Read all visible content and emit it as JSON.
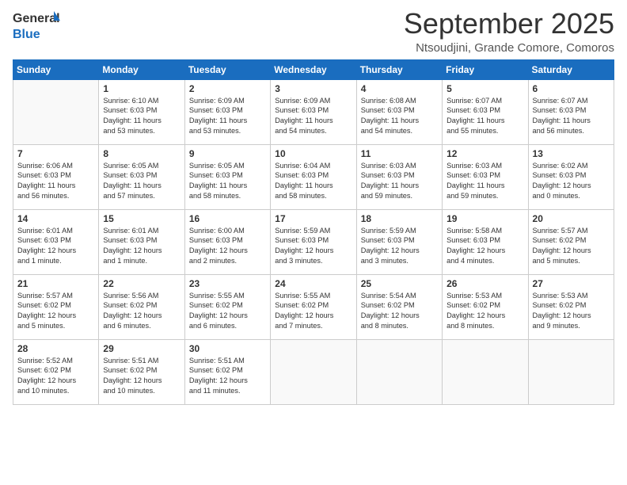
{
  "logo": {
    "general": "General",
    "blue": "Blue"
  },
  "header": {
    "month": "September 2025",
    "location": "Ntsoudjini, Grande Comore, Comoros"
  },
  "days": [
    "Sunday",
    "Monday",
    "Tuesday",
    "Wednesday",
    "Thursday",
    "Friday",
    "Saturday"
  ],
  "weeks": [
    [
      {
        "num": "",
        "lines": []
      },
      {
        "num": "1",
        "lines": [
          "Sunrise: 6:10 AM",
          "Sunset: 6:03 PM",
          "Daylight: 11 hours",
          "and 53 minutes."
        ]
      },
      {
        "num": "2",
        "lines": [
          "Sunrise: 6:09 AM",
          "Sunset: 6:03 PM",
          "Daylight: 11 hours",
          "and 53 minutes."
        ]
      },
      {
        "num": "3",
        "lines": [
          "Sunrise: 6:09 AM",
          "Sunset: 6:03 PM",
          "Daylight: 11 hours",
          "and 54 minutes."
        ]
      },
      {
        "num": "4",
        "lines": [
          "Sunrise: 6:08 AM",
          "Sunset: 6:03 PM",
          "Daylight: 11 hours",
          "and 54 minutes."
        ]
      },
      {
        "num": "5",
        "lines": [
          "Sunrise: 6:07 AM",
          "Sunset: 6:03 PM",
          "Daylight: 11 hours",
          "and 55 minutes."
        ]
      },
      {
        "num": "6",
        "lines": [
          "Sunrise: 6:07 AM",
          "Sunset: 6:03 PM",
          "Daylight: 11 hours",
          "and 56 minutes."
        ]
      }
    ],
    [
      {
        "num": "7",
        "lines": [
          "Sunrise: 6:06 AM",
          "Sunset: 6:03 PM",
          "Daylight: 11 hours",
          "and 56 minutes."
        ]
      },
      {
        "num": "8",
        "lines": [
          "Sunrise: 6:05 AM",
          "Sunset: 6:03 PM",
          "Daylight: 11 hours",
          "and 57 minutes."
        ]
      },
      {
        "num": "9",
        "lines": [
          "Sunrise: 6:05 AM",
          "Sunset: 6:03 PM",
          "Daylight: 11 hours",
          "and 58 minutes."
        ]
      },
      {
        "num": "10",
        "lines": [
          "Sunrise: 6:04 AM",
          "Sunset: 6:03 PM",
          "Daylight: 11 hours",
          "and 58 minutes."
        ]
      },
      {
        "num": "11",
        "lines": [
          "Sunrise: 6:03 AM",
          "Sunset: 6:03 PM",
          "Daylight: 11 hours",
          "and 59 minutes."
        ]
      },
      {
        "num": "12",
        "lines": [
          "Sunrise: 6:03 AM",
          "Sunset: 6:03 PM",
          "Daylight: 11 hours",
          "and 59 minutes."
        ]
      },
      {
        "num": "13",
        "lines": [
          "Sunrise: 6:02 AM",
          "Sunset: 6:03 PM",
          "Daylight: 12 hours",
          "and 0 minutes."
        ]
      }
    ],
    [
      {
        "num": "14",
        "lines": [
          "Sunrise: 6:01 AM",
          "Sunset: 6:03 PM",
          "Daylight: 12 hours",
          "and 1 minute."
        ]
      },
      {
        "num": "15",
        "lines": [
          "Sunrise: 6:01 AM",
          "Sunset: 6:03 PM",
          "Daylight: 12 hours",
          "and 1 minute."
        ]
      },
      {
        "num": "16",
        "lines": [
          "Sunrise: 6:00 AM",
          "Sunset: 6:03 PM",
          "Daylight: 12 hours",
          "and 2 minutes."
        ]
      },
      {
        "num": "17",
        "lines": [
          "Sunrise: 5:59 AM",
          "Sunset: 6:03 PM",
          "Daylight: 12 hours",
          "and 3 minutes."
        ]
      },
      {
        "num": "18",
        "lines": [
          "Sunrise: 5:59 AM",
          "Sunset: 6:03 PM",
          "Daylight: 12 hours",
          "and 3 minutes."
        ]
      },
      {
        "num": "19",
        "lines": [
          "Sunrise: 5:58 AM",
          "Sunset: 6:03 PM",
          "Daylight: 12 hours",
          "and 4 minutes."
        ]
      },
      {
        "num": "20",
        "lines": [
          "Sunrise: 5:57 AM",
          "Sunset: 6:02 PM",
          "Daylight: 12 hours",
          "and 5 minutes."
        ]
      }
    ],
    [
      {
        "num": "21",
        "lines": [
          "Sunrise: 5:57 AM",
          "Sunset: 6:02 PM",
          "Daylight: 12 hours",
          "and 5 minutes."
        ]
      },
      {
        "num": "22",
        "lines": [
          "Sunrise: 5:56 AM",
          "Sunset: 6:02 PM",
          "Daylight: 12 hours",
          "and 6 minutes."
        ]
      },
      {
        "num": "23",
        "lines": [
          "Sunrise: 5:55 AM",
          "Sunset: 6:02 PM",
          "Daylight: 12 hours",
          "and 6 minutes."
        ]
      },
      {
        "num": "24",
        "lines": [
          "Sunrise: 5:55 AM",
          "Sunset: 6:02 PM",
          "Daylight: 12 hours",
          "and 7 minutes."
        ]
      },
      {
        "num": "25",
        "lines": [
          "Sunrise: 5:54 AM",
          "Sunset: 6:02 PM",
          "Daylight: 12 hours",
          "and 8 minutes."
        ]
      },
      {
        "num": "26",
        "lines": [
          "Sunrise: 5:53 AM",
          "Sunset: 6:02 PM",
          "Daylight: 12 hours",
          "and 8 minutes."
        ]
      },
      {
        "num": "27",
        "lines": [
          "Sunrise: 5:53 AM",
          "Sunset: 6:02 PM",
          "Daylight: 12 hours",
          "and 9 minutes."
        ]
      }
    ],
    [
      {
        "num": "28",
        "lines": [
          "Sunrise: 5:52 AM",
          "Sunset: 6:02 PM",
          "Daylight: 12 hours",
          "and 10 minutes."
        ]
      },
      {
        "num": "29",
        "lines": [
          "Sunrise: 5:51 AM",
          "Sunset: 6:02 PM",
          "Daylight: 12 hours",
          "and 10 minutes."
        ]
      },
      {
        "num": "30",
        "lines": [
          "Sunrise: 5:51 AM",
          "Sunset: 6:02 PM",
          "Daylight: 12 hours",
          "and 11 minutes."
        ]
      },
      {
        "num": "",
        "lines": []
      },
      {
        "num": "",
        "lines": []
      },
      {
        "num": "",
        "lines": []
      },
      {
        "num": "",
        "lines": []
      }
    ]
  ]
}
